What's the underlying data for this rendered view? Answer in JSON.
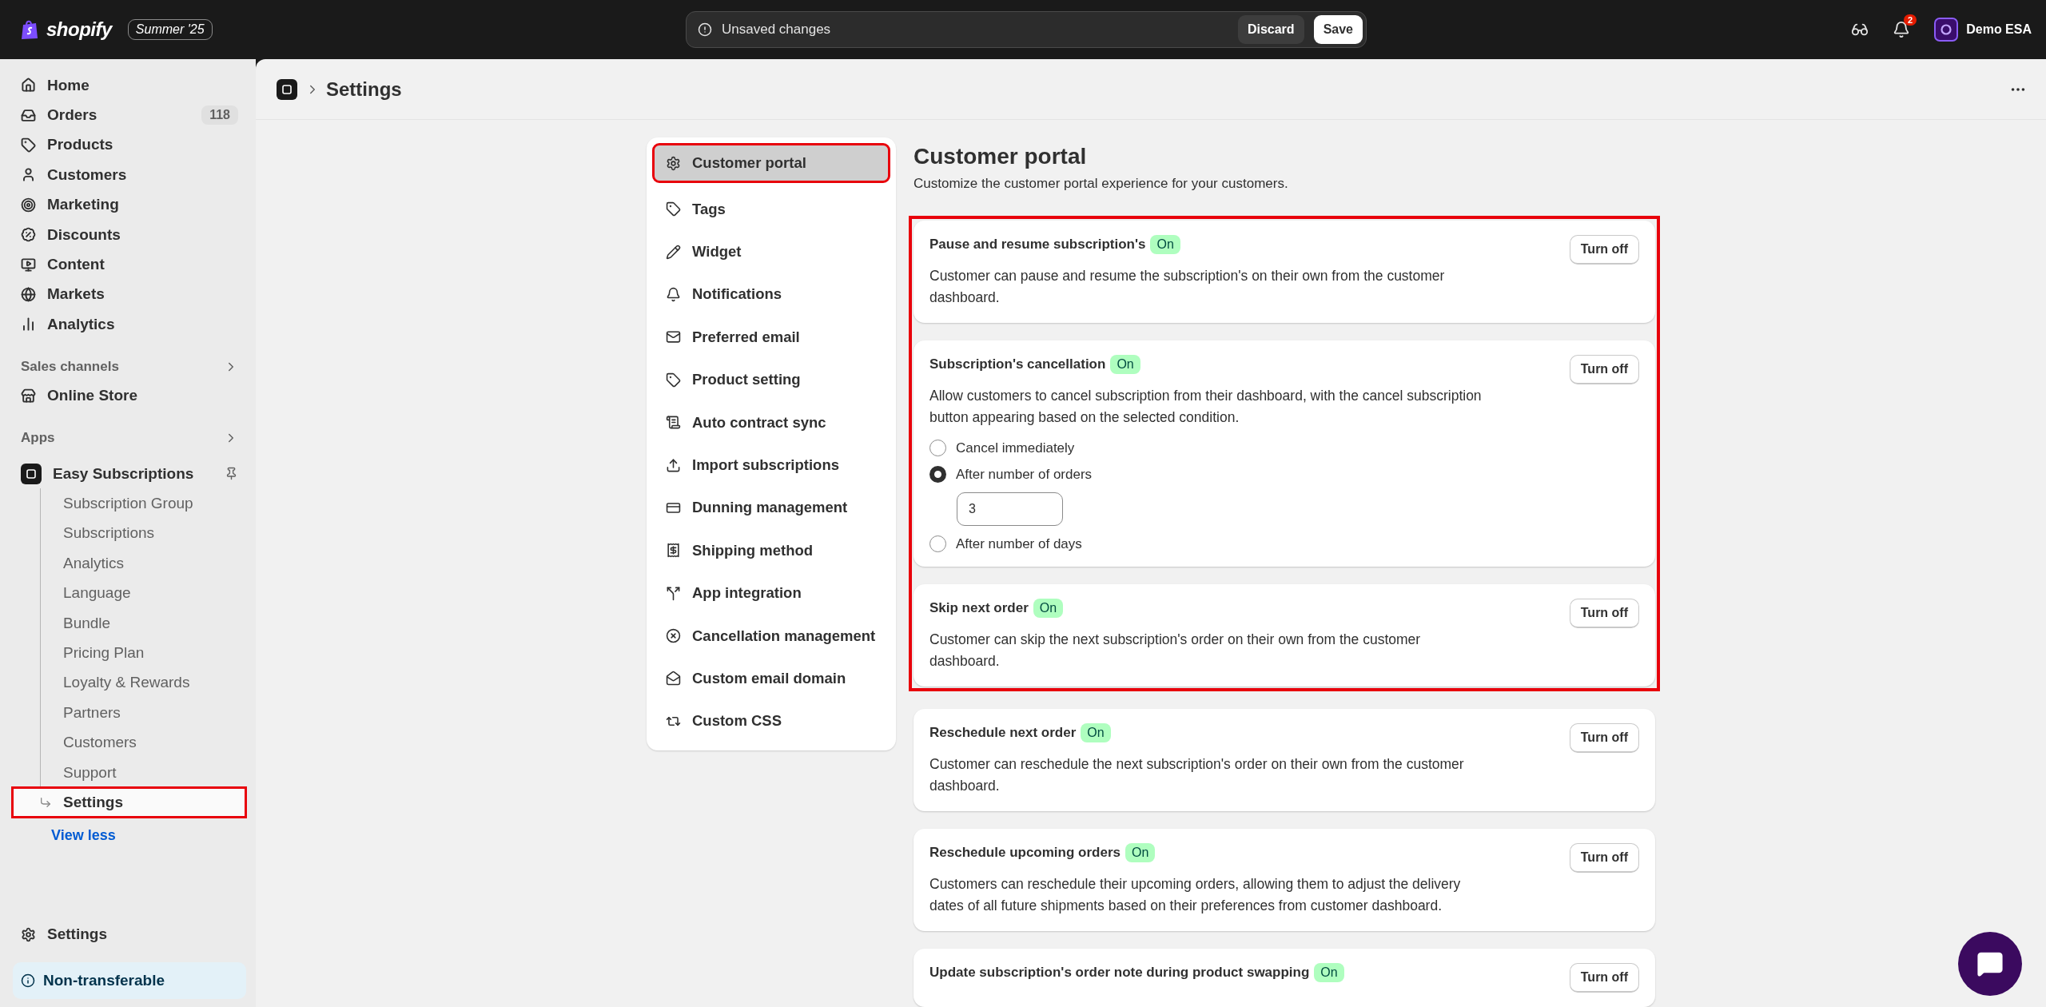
{
  "topbar": {
    "logo_text": "shopify",
    "edition": "Summer '25",
    "unsaved": {
      "message": "Unsaved changes",
      "discard": "Discard",
      "save": "Save"
    },
    "notification_count": "2",
    "store": "Demo ESA"
  },
  "sidebar": {
    "items": [
      {
        "label": "Home",
        "selected": false
      },
      {
        "label": "Orders",
        "badge": "118",
        "selected": false
      },
      {
        "label": "Products",
        "selected": false
      },
      {
        "label": "Customers",
        "selected": false
      },
      {
        "label": "Marketing",
        "selected": false
      },
      {
        "label": "Discounts",
        "selected": false
      },
      {
        "label": "Content",
        "selected": false
      },
      {
        "label": "Markets",
        "selected": false
      },
      {
        "label": "Analytics",
        "selected": false
      }
    ],
    "sales_channels": {
      "heading": "Sales channels",
      "items": [
        {
          "label": "Online Store",
          "selected": false
        }
      ]
    },
    "apps": {
      "heading": "Apps",
      "app": {
        "label": "Easy Subscriptions",
        "children": [
          {
            "label": "Subscription Group",
            "selected": false,
            "highlighted": false
          },
          {
            "label": "Subscriptions",
            "selected": false,
            "highlighted": false
          },
          {
            "label": "Analytics",
            "selected": false,
            "highlighted": false
          },
          {
            "label": "Language",
            "selected": false,
            "highlighted": false
          },
          {
            "label": "Bundle",
            "selected": false,
            "highlighted": false
          },
          {
            "label": "Pricing Plan",
            "selected": false,
            "highlighted": false
          },
          {
            "label": "Loyalty & Rewards",
            "selected": false,
            "highlighted": false
          },
          {
            "label": "Partners",
            "selected": false,
            "highlighted": false
          },
          {
            "label": "Customers",
            "selected": false,
            "highlighted": false
          },
          {
            "label": "Support",
            "selected": false,
            "highlighted": false
          },
          {
            "label": "Settings",
            "selected": true,
            "highlighted": true
          }
        ]
      },
      "view_less": "View less"
    },
    "settings": "Settings",
    "notice": "Non-transferable"
  },
  "page": {
    "title": "Settings"
  },
  "settings_nav": [
    {
      "label": "Customer portal",
      "selected": true,
      "highlighted": true
    },
    {
      "label": "Tags",
      "selected": false,
      "highlighted": false
    },
    {
      "label": "Widget",
      "selected": false,
      "highlighted": false
    },
    {
      "label": "Notifications",
      "selected": false,
      "highlighted": false
    },
    {
      "label": "Preferred email",
      "selected": false,
      "highlighted": false
    },
    {
      "label": "Product setting",
      "selected": false,
      "highlighted": false
    },
    {
      "label": "Auto contract sync",
      "selected": false,
      "highlighted": false
    },
    {
      "label": "Import subscriptions",
      "selected": false,
      "highlighted": false
    },
    {
      "label": "Dunning management",
      "selected": false,
      "highlighted": false
    },
    {
      "label": "Shipping method",
      "selected": false,
      "highlighted": false
    },
    {
      "label": "App integration",
      "selected": false,
      "highlighted": false
    },
    {
      "label": "Cancellation management",
      "selected": false,
      "highlighted": false
    },
    {
      "label": "Custom email domain",
      "selected": false,
      "highlighted": false
    },
    {
      "label": "Custom CSS",
      "selected": false,
      "highlighted": false
    }
  ],
  "content": {
    "title": "Customer portal",
    "subtitle": "Customize the customer portal experience for your customers.",
    "cards": [
      {
        "title": "Pause and resume subscription's",
        "status": "On",
        "description": "Customer can pause and resume the subscription's on their own from the customer dashboard.",
        "button": "Turn off",
        "highlighted": true
      },
      {
        "title": "Subscription's cancellation",
        "status": "On",
        "description": "Allow customers to cancel subscription from their dashboard, with the cancel subscription button appearing based on the selected condition.",
        "button": "Turn off",
        "highlighted": true,
        "options": [
          {
            "label": "Cancel immediately",
            "selected": false
          },
          {
            "label": "After number of orders",
            "selected": true,
            "value": "3"
          },
          {
            "label": "After number of days",
            "selected": false
          }
        ]
      },
      {
        "title": "Skip next order",
        "status": "On",
        "description": "Customer can skip the next subscription's order on their own from the customer dashboard.",
        "button": "Turn off",
        "highlighted": true
      },
      {
        "title": "Reschedule next order",
        "status": "On",
        "description": "Customer can reschedule the next subscription's order on their own from the customer dashboard.",
        "button": "Turn off",
        "highlighted": false
      },
      {
        "title": "Reschedule upcoming orders",
        "status": "On",
        "description": "Customers can reschedule their upcoming orders, allowing them to adjust the delivery dates of all future shipments based on their preferences from customer dashboard.",
        "button": "Turn off",
        "highlighted": false
      },
      {
        "title": "Update subscription's order note during product swapping",
        "status": "On",
        "button": "Turn off",
        "highlighted": false
      }
    ]
  }
}
